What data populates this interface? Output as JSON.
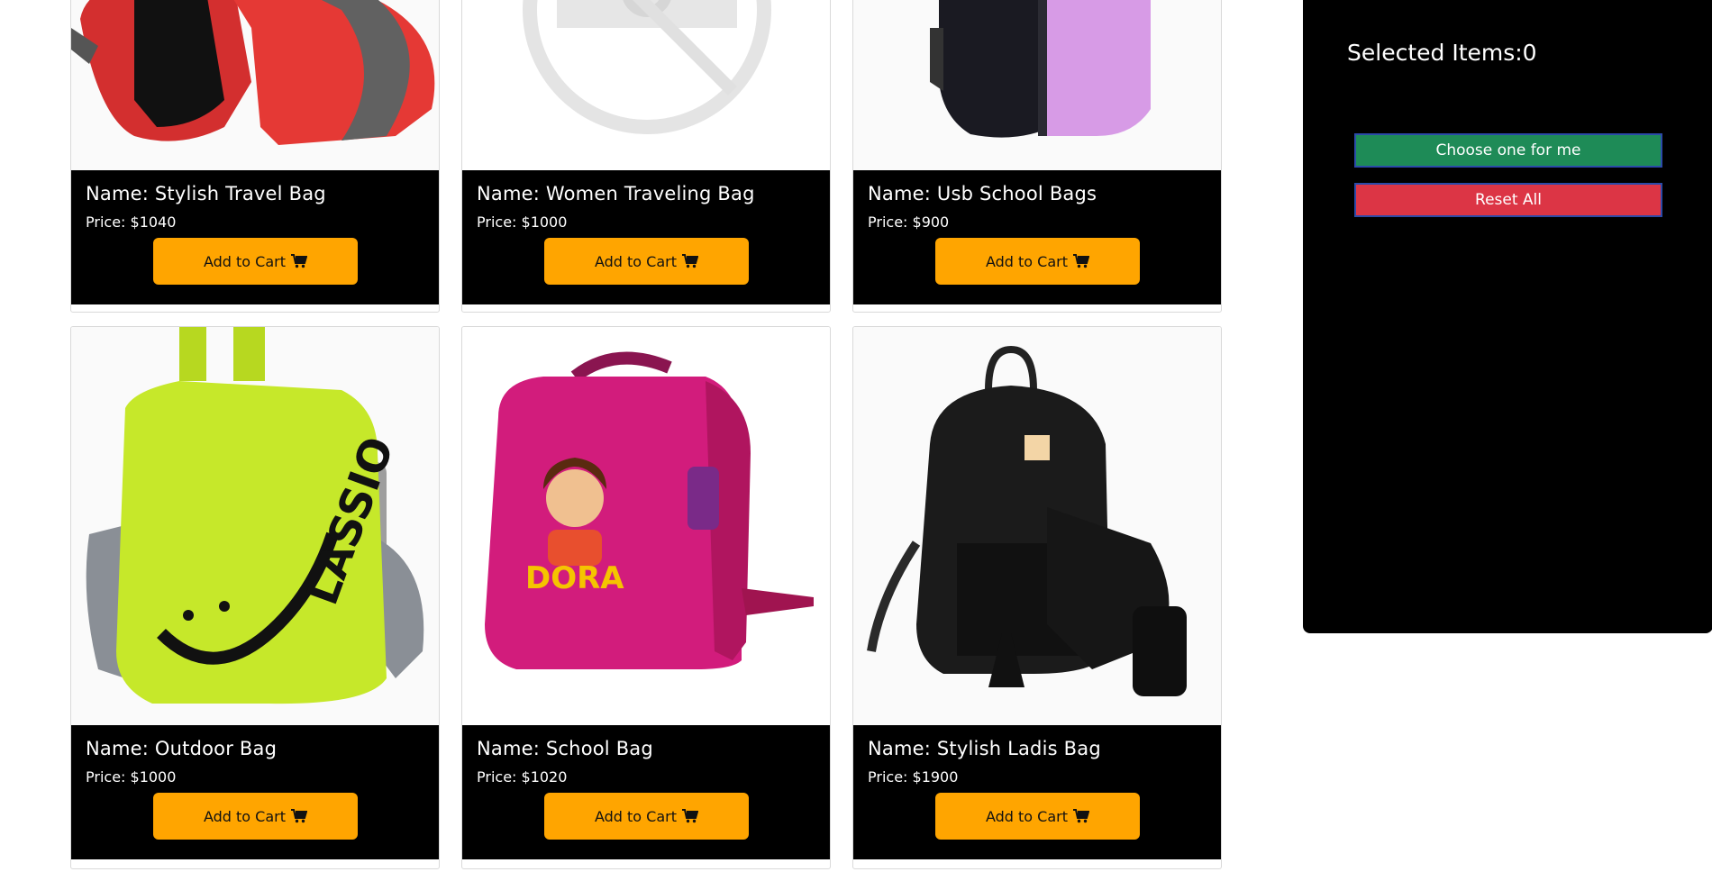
{
  "products": [
    {
      "name": "Name: Stylish Travel Bag",
      "price": "Price: $1040",
      "button": "Add to Cart",
      "image": "red-backpack-image"
    },
    {
      "name": "Name: Women Traveling Bag",
      "price": "Price: $1000",
      "button": "Add to Cart",
      "image": "image-unavailable-icon"
    },
    {
      "name": "Name: Usb School Bags",
      "price": "Price: $900",
      "button": "Add to Cart",
      "image": "purple-backpack-image"
    },
    {
      "name": "Name: Outdoor Bag",
      "price": "Price: $1000",
      "button": "Add to Cart",
      "image": "lime-backpack-image"
    },
    {
      "name": "Name: School Bag",
      "price": "Price: $1020",
      "button": "Add to Cart",
      "image": "pink-backpack-image"
    },
    {
      "name": "Name: Stylish Ladis Bag",
      "price": "Price: $1900",
      "button": "Add to Cart",
      "image": "black-quilted-backpack-image"
    }
  ],
  "panel": {
    "title": "Selected Items:0",
    "choose_label": "Choose one for me",
    "reset_label": "Reset All"
  },
  "icons": {
    "cart": "shopping-cart-icon"
  },
  "colors": {
    "add_to_cart": "#ffa500",
    "choose_button": "#1e8b57",
    "reset_button": "#dc3545",
    "panel_bg": "#000000",
    "card_info_bg": "#000000"
  }
}
